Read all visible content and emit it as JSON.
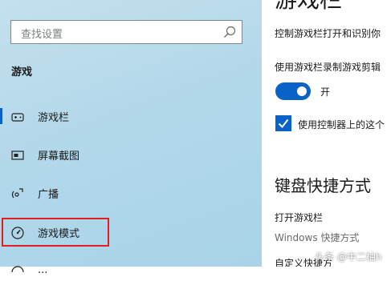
{
  "search": {
    "placeholder": "查找设置"
  },
  "sidebar": {
    "category": "游戏",
    "items": [
      {
        "label": "游戏栏",
        "icon": "game-bar-icon"
      },
      {
        "label": "屏幕截图",
        "icon": "screenshot-icon"
      },
      {
        "label": "广播",
        "icon": "broadcast-icon"
      },
      {
        "label": "游戏模式",
        "icon": "game-mode-icon"
      },
      {
        "label": "...",
        "icon": "network-icon"
      }
    ]
  },
  "main": {
    "title": "游戏栏",
    "control_text": "控制游戏栏打开和识别你",
    "record_text": "使用游戏栏录制游戏剪辑",
    "toggle_label": "开",
    "toggle_on": true,
    "checkbox_label": "使用控制器上的这个",
    "checkbox_checked": true,
    "section_title": "键盘快捷方式",
    "shortcut_label": "打开游戏栏",
    "shortcut_value": "Windows 快捷方式",
    "custom_label": "自定义快捷方"
  },
  "watermark": "头条 @中二柚h",
  "colors": {
    "accent": "#0a62c8",
    "highlight": "#e02020"
  }
}
